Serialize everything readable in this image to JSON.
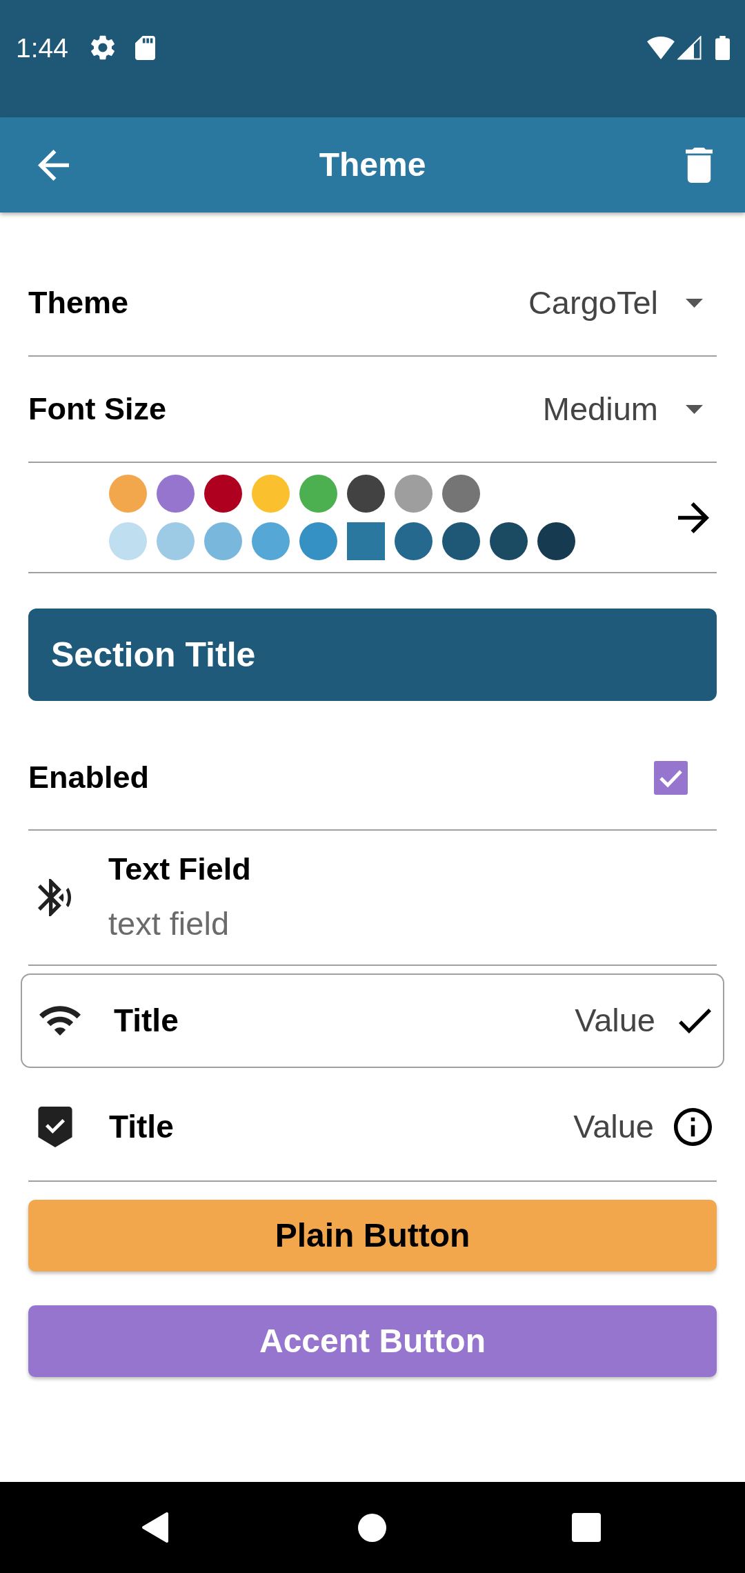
{
  "status_bar": {
    "time": "1:44"
  },
  "app_bar": {
    "title": "Theme"
  },
  "settings": [
    {
      "kind": "dropdown",
      "label": "Theme",
      "value": "CargoTel"
    },
    {
      "kind": "dropdown",
      "label": "Font Size",
      "value": "Medium"
    }
  ],
  "palette": {
    "rows": [
      {
        "swatches": [
          {
            "color": "#f2a74c",
            "selected": false
          },
          {
            "color": "#9575cd",
            "selected": false
          },
          {
            "color": "#b00020",
            "selected": false
          },
          {
            "color": "#fbc02d",
            "selected": false
          },
          {
            "color": "#4caf50",
            "selected": false
          },
          {
            "color": "#424242",
            "selected": false
          },
          {
            "color": "#9e9e9e",
            "selected": false
          },
          {
            "color": "#757575",
            "selected": false
          }
        ]
      },
      {
        "swatches": [
          {
            "color": "#bfdeef",
            "selected": false
          },
          {
            "color": "#9dcbe5",
            "selected": false
          },
          {
            "color": "#79b8dc",
            "selected": false
          },
          {
            "color": "#55a7d5",
            "selected": false
          },
          {
            "color": "#3591c4",
            "selected": false
          },
          {
            "color": "#2a789f",
            "selected": true
          },
          {
            "color": "#256a8e",
            "selected": false
          },
          {
            "color": "#1f5877",
            "selected": false
          },
          {
            "color": "#1b4a63",
            "selected": false
          },
          {
            "color": "#163a4f",
            "selected": false
          }
        ]
      }
    ]
  },
  "section_title": "Section Title",
  "rows": [
    {
      "kind": "checkbox",
      "label": "Enabled",
      "checked": true
    },
    {
      "kind": "text_field",
      "label": "Text Field",
      "placeholder": "text field"
    },
    {
      "kind": "value",
      "title": "Title",
      "value": "Value",
      "selected": true
    },
    {
      "kind": "value",
      "title": "Title",
      "value": "Value",
      "selected": false
    }
  ],
  "buttons": [
    {
      "kind": "plain",
      "label": "Plain Button"
    },
    {
      "kind": "accent",
      "label": "Accent Button"
    }
  ]
}
